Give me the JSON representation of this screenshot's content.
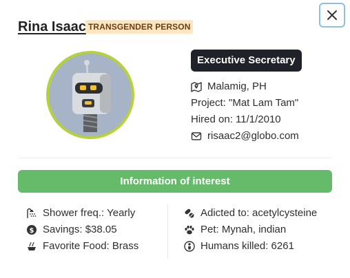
{
  "person": {
    "name": "Rina Isaac",
    "badge": "TRANSGENDER PERSON",
    "role": "Executive Secretary",
    "location": "Malamig, PH",
    "project": "Project: \"Mat Lam Tam\"",
    "hired": "Hired on: 11/1/2010",
    "email": "risaac2@globo.com"
  },
  "section": {
    "title": "Information of interest"
  },
  "attributes": {
    "left": [
      {
        "icon": "shower-icon",
        "text": "Shower freq.: Yearly"
      },
      {
        "icon": "dollar-coin-icon",
        "text": "Savings: $38.05"
      },
      {
        "icon": "food-icon",
        "text": "Favorite Food: Brass"
      }
    ],
    "right": [
      {
        "icon": "pills-icon",
        "text": "Adicted to: acetylcysteine"
      },
      {
        "icon": "paw-icon",
        "text": "Pet: Mynah, indian"
      },
      {
        "icon": "person-icon",
        "text": "Humans killed: 6261"
      }
    ]
  },
  "colors": {
    "avatar_ring": "#b4d33a",
    "role_bg": "#1f2329",
    "section_bg": "#65bb6a",
    "badge_bg": "#fde7c2",
    "close_border": "#8fbfe0"
  },
  "icons": {
    "close": "close-icon",
    "location": "map-pin-icon",
    "email": "envelope-icon"
  }
}
